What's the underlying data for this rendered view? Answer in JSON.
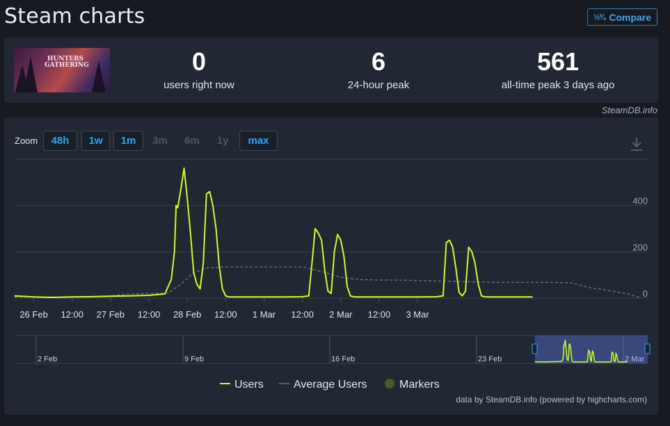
{
  "page": {
    "title": "Steam charts",
    "compare_label": "Compare",
    "compare_icon": "fraction-icon"
  },
  "stats": [
    {
      "value": "0",
      "label": "users right now"
    },
    {
      "value": "6",
      "label": "24-hour peak"
    },
    {
      "value": "561",
      "label": "all-time peak 3 days ago"
    }
  ],
  "game": {
    "logo_text": "HUNTERS GATHERING"
  },
  "credit_top": "SteamDB.info",
  "zoom": {
    "label": "Zoom",
    "buttons": [
      {
        "label": "48h",
        "enabled": true
      },
      {
        "label": "1w",
        "enabled": true
      },
      {
        "label": "1m",
        "enabled": true
      },
      {
        "label": "3m",
        "enabled": false
      },
      {
        "label": "6m",
        "enabled": false
      },
      {
        "label": "1y",
        "enabled": false
      },
      {
        "label": "max",
        "enabled": true,
        "selected": true
      }
    ]
  },
  "chart_data": {
    "type": "line",
    "x_axis": {
      "tick_labels": [
        "26 Feb",
        "12:00",
        "27 Feb",
        "12:00",
        "28 Feb",
        "12:00",
        "1 Mar",
        "12:00",
        "2 Mar",
        "12:00",
        "3 Mar"
      ],
      "range_hours": [
        -6,
        192
      ]
    },
    "y_axis": {
      "tick_labels": [
        "0",
        "200",
        "400"
      ],
      "tick_values": [
        0,
        200,
        400
      ],
      "ylim": [
        0,
        600
      ],
      "position": "right"
    },
    "grid": true,
    "legend_position": "bottom-center",
    "series": [
      {
        "name": "Users",
        "color": "#cbff1f",
        "x_hours": [
          -6,
          0,
          6,
          12,
          18,
          24,
          30,
          36,
          41,
          43,
          44,
          44.5,
          45,
          46,
          47,
          48,
          49,
          50,
          51,
          52,
          53,
          54,
          55,
          56,
          57,
          58,
          59,
          60,
          61,
          62,
          64,
          66,
          72,
          78,
          84,
          86,
          87,
          88,
          89,
          90,
          91,
          92,
          93,
          94,
          95,
          96,
          97,
          98,
          99,
          100,
          101,
          102,
          104,
          108,
          114,
          120,
          126,
          128,
          129,
          130,
          131,
          132,
          133,
          134,
          135,
          136,
          137,
          138,
          139,
          140,
          141,
          142,
          144,
          150,
          156
        ],
        "values": [
          10,
          5,
          3,
          5,
          6,
          8,
          10,
          12,
          18,
          80,
          200,
          400,
          390,
          470,
          561,
          430,
          280,
          110,
          60,
          40,
          150,
          450,
          460,
          400,
          300,
          140,
          40,
          10,
          5,
          5,
          5,
          5,
          5,
          5,
          6,
          10,
          150,
          300,
          280,
          250,
          120,
          30,
          20,
          200,
          275,
          250,
          180,
          50,
          10,
          6,
          5,
          5,
          5,
          5,
          5,
          5,
          6,
          10,
          240,
          250,
          220,
          130,
          25,
          10,
          30,
          220,
          200,
          150,
          60,
          10,
          6,
          5,
          5,
          5,
          5
        ]
      },
      {
        "name": "Average Users",
        "color": "#6c7480",
        "dashed": true,
        "x_hours": [
          -6,
          0,
          12,
          24,
          30,
          36,
          42,
          46,
          50,
          54,
          60,
          66,
          72,
          78,
          84,
          90,
          96,
          102,
          108,
          114,
          120,
          126,
          132,
          138,
          144,
          150,
          156,
          162,
          168,
          174,
          180,
          186,
          190
        ],
        "values": [
          5,
          5,
          6,
          10,
          18,
          20,
          22,
          60,
          110,
          130,
          135,
          135,
          135,
          135,
          135,
          115,
          90,
          80,
          78,
          78,
          76,
          74,
          72,
          70,
          68,
          68,
          68,
          68,
          66,
          45,
          32,
          18,
          0
        ]
      },
      {
        "name": "Markers",
        "color": "#48592a"
      }
    ]
  },
  "navigator": {
    "labels": [
      "2 Feb",
      "9 Feb",
      "16 Feb",
      "23 Feb",
      "2 Mar"
    ]
  },
  "credit_bottom": "data by SteamDB.info (powered by highcharts.com)"
}
